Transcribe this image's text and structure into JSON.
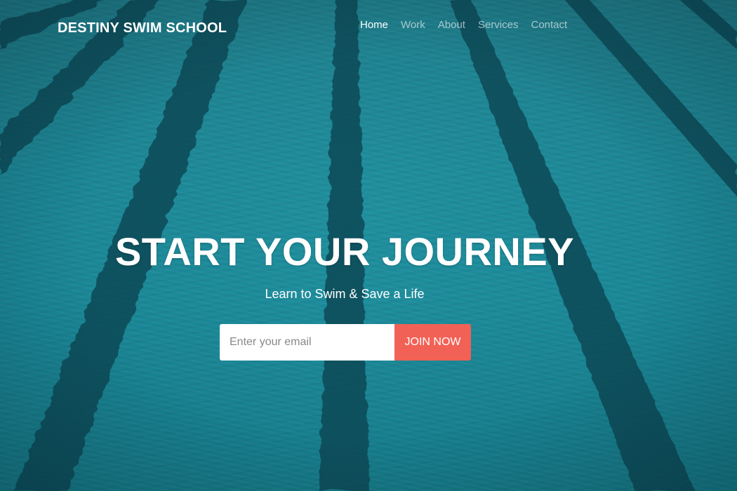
{
  "brand": {
    "name": "DESTINY SWIM SCHOOL"
  },
  "nav": {
    "items": [
      {
        "label": "Home",
        "active": true
      },
      {
        "label": "Work",
        "active": false
      },
      {
        "label": "About",
        "active": false
      },
      {
        "label": "Services",
        "active": false
      },
      {
        "label": "Contact",
        "active": false
      }
    ]
  },
  "hero": {
    "title": "START YOUR JOURNEY",
    "subtitle": "Learn to Swim & Save a Life",
    "background_image": "swimming-pool-lanes",
    "form": {
      "email_placeholder": "Enter your email",
      "email_value": "",
      "button_label": "JOIN NOW"
    }
  },
  "colors": {
    "water": "#1c8694",
    "lane_line": "#0f4a57",
    "accent": "#f26155",
    "text": "#ffffff"
  }
}
